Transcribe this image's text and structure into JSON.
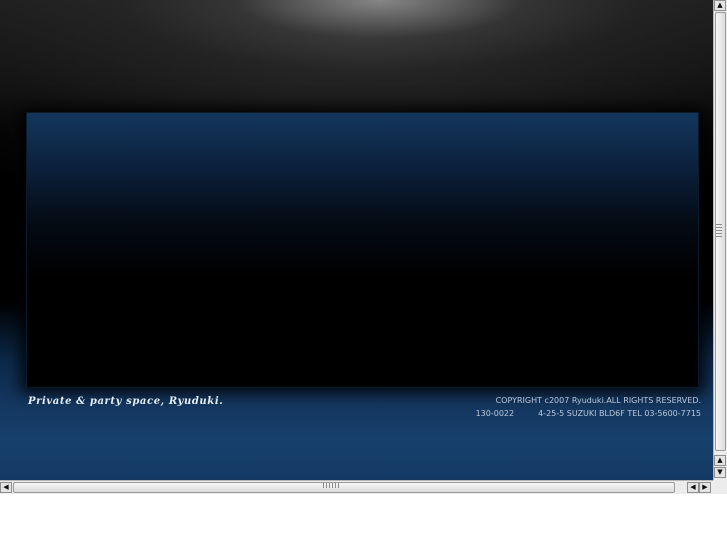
{
  "site": {
    "tagline": "Private & party space, Ryuduki.",
    "copyright": "COPYRIGHT c2007 Ryuduki.ALL RIGHTS RESERVED.",
    "postal_code": "130-0022",
    "address": "4-25-5 SUZUKI BLD6F TEL 03-5600-7715"
  },
  "scrollbars": {
    "up_arrow": "▲",
    "down_arrow": "▼",
    "left_arrow": "◀",
    "right_arrow": "▶"
  },
  "colors": {
    "page_background_bottom": "#16406c",
    "panel_top": "#13365c",
    "panel_bottom": "#000000",
    "footer_text": "#b8c8da",
    "tagline_text": "#e6eef6"
  }
}
